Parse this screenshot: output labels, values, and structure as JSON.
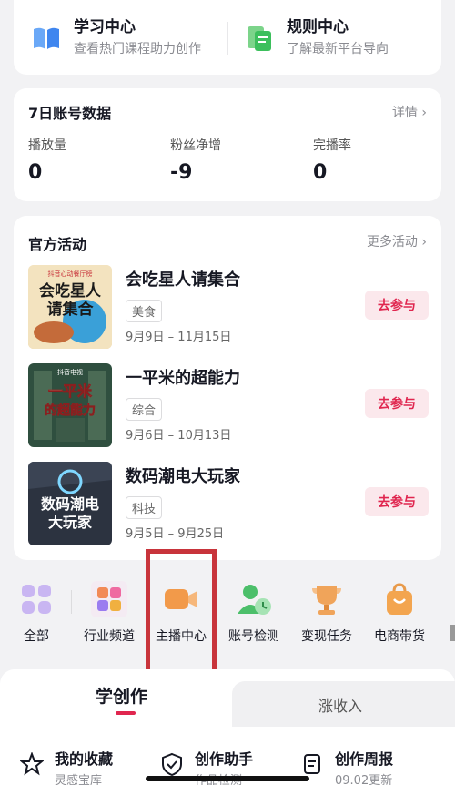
{
  "quick_links": [
    {
      "title": "学习中心",
      "subtitle": "查看热门课程助力创作",
      "icon": "book-icon"
    },
    {
      "title": "规则中心",
      "subtitle": "了解最新平台导向",
      "icon": "rules-icon"
    }
  ],
  "stats": {
    "title": "7日账号数据",
    "detail": "详情",
    "items": [
      {
        "label": "播放量",
        "value": "0"
      },
      {
        "label": "粉丝净增",
        "value": "-9"
      },
      {
        "label": "完播率",
        "value": "0"
      }
    ]
  },
  "activities": {
    "title": "官方活动",
    "more": "更多活动",
    "join_label": "去参与",
    "items": [
      {
        "name": "会吃星人请集合",
        "tag": "美食",
        "dates": "9月9日 – 11月15日",
        "thumb_text": "会吃星人\n请集合",
        "thumb_top": "抖音心动餐厅榜"
      },
      {
        "name": "一平米的超能力",
        "tag": "综合",
        "dates": "9月6日 – 10月13日",
        "thumb_text": "一平米\n的超能力",
        "thumb_top": "抖音电视"
      },
      {
        "name": "数码潮电大玩家",
        "tag": "科技",
        "dates": "9月5日 – 9月25日",
        "thumb_text": "数码潮电\n大玩家",
        "thumb_top": ""
      }
    ]
  },
  "categories": [
    {
      "label": "全部",
      "icon": "grid-icon"
    },
    {
      "label": "行业频道",
      "icon": "industry-icon"
    },
    {
      "label": "主播中心",
      "icon": "video-camera-icon"
    },
    {
      "label": "账号检测",
      "icon": "account-check-icon"
    },
    {
      "label": "变现任务",
      "icon": "trophy-icon"
    },
    {
      "label": "电商带货",
      "icon": "shopping-bag-icon"
    }
  ],
  "tabs": {
    "left": "学创作",
    "right": "涨收入"
  },
  "tools": [
    {
      "title": "我的收藏",
      "subtitle": "灵感宝库",
      "icon": "star-icon"
    },
    {
      "title": "创作助手",
      "subtitle": "作品检测",
      "icon": "shield-icon"
    },
    {
      "title": "创作周报",
      "subtitle": "09.02更新",
      "icon": "report-icon"
    }
  ],
  "colors": {
    "accent": "#e0264f",
    "highlight_box": "#c8343b",
    "camera": "#f29a4a"
  }
}
